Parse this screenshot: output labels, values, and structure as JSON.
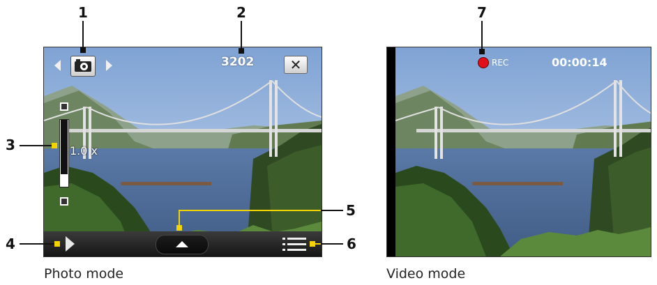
{
  "callouts": {
    "c1": "1",
    "c2": "2",
    "c3": "3",
    "c4": "4",
    "c5": "5",
    "c6": "6",
    "c7": "7"
  },
  "photo_screen": {
    "mode_icon": "camera-icon",
    "counter": "3202",
    "close_label": "✕",
    "zoom_label": "1.0 x",
    "caption": "Photo mode"
  },
  "video_screen": {
    "rec_label": "REC",
    "elapsed_time": "00:00:14",
    "caption": "Video mode"
  },
  "colors": {
    "callout_yellow": "#f4d400",
    "rec_red": "#e0101a",
    "bar_dark": "#151515"
  }
}
